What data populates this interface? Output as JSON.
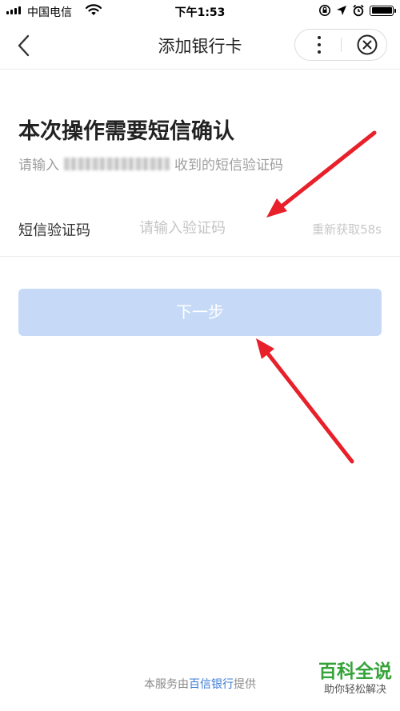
{
  "status_bar": {
    "carrier": "中国电信",
    "time": "下午1:53",
    "icons": [
      "signal-icon",
      "wifi-icon",
      "rotation-lock-icon",
      "location-icon",
      "alarm-icon",
      "battery-icon"
    ]
  },
  "nav": {
    "title": "添加银行卡",
    "icons": [
      "back-chevron-icon",
      "more-dots-icon",
      "close-circle-icon"
    ]
  },
  "main": {
    "heading": "本次操作需要短信确认",
    "sub_prefix": "请输入",
    "sub_suffix": "收到的短信验证码",
    "code_label": "短信验证码",
    "code_placeholder": "请输入验证码",
    "code_value": "",
    "resend": "重新获取58s",
    "next_button": "下一步"
  },
  "footer": {
    "prefix": "本服务由",
    "bank": "百信银行",
    "suffix": "提供"
  },
  "watermark": {
    "main": "百科全说",
    "sub": "助你轻松解决"
  },
  "colors": {
    "button_disabled": "#c6daf8",
    "link": "#3a7ad6",
    "arrow": "#e8202a",
    "watermark": "#35a33a"
  }
}
